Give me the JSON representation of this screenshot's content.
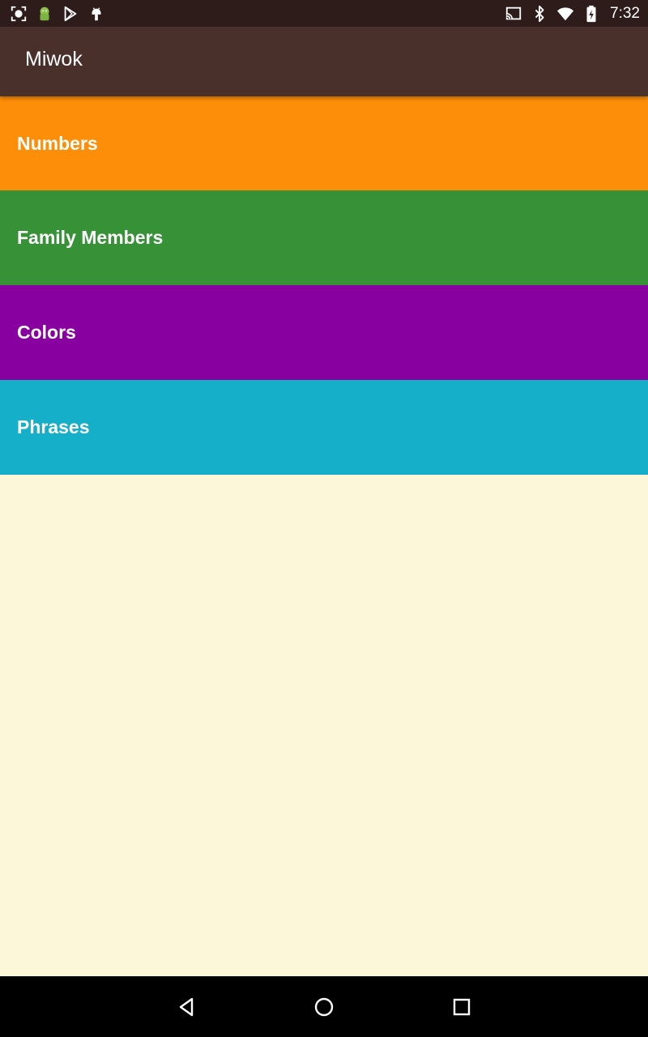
{
  "status_bar": {
    "left_icons": [
      "screenshot-icon",
      "android-app-icon",
      "play-store-icon",
      "android-debug-icon"
    ],
    "right_icons": [
      "cast-icon",
      "bluetooth-icon",
      "wifi-icon",
      "battery-charging-icon"
    ],
    "time": "7:32",
    "background_color": "#2E1C1A"
  },
  "app_bar": {
    "title": "Miwok",
    "background_color": "#4A302A"
  },
  "categories": [
    {
      "label": "Numbers",
      "color": "#FD8E09"
    },
    {
      "label": "Family Members",
      "color": "#379237"
    },
    {
      "label": "Colors",
      "color": "#8800A0"
    },
    {
      "label": "Phrases",
      "color": "#16AFCA"
    }
  ],
  "content_background": "#FDF7DA",
  "nav_bar": {
    "buttons": [
      "back-icon",
      "home-icon",
      "recents-icon"
    ]
  }
}
